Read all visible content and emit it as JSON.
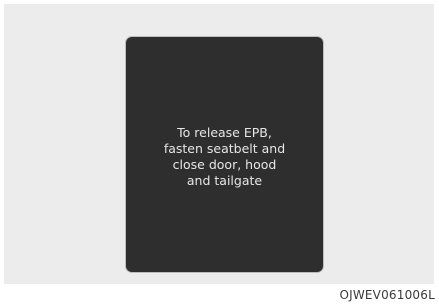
{
  "display": {
    "message_lines": [
      "To release EPB,",
      "fasten seatbelt and",
      "close door, hood",
      "and tailgate"
    ]
  },
  "figure_code": "OJWEV061006L"
}
